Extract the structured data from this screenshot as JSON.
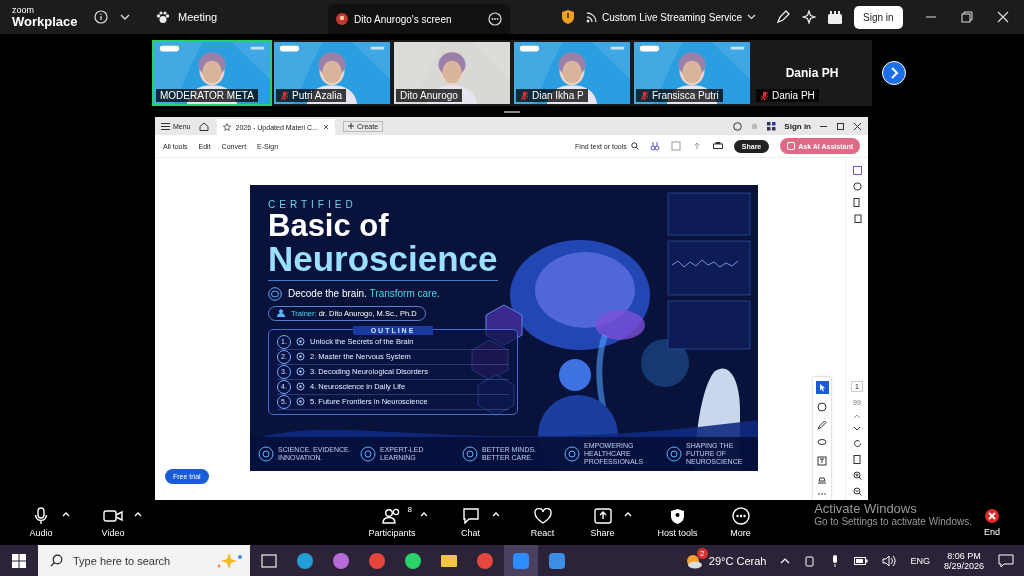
{
  "app": {
    "brand_top": "zoom",
    "brand_bottom": "Workplace",
    "meeting_label": "Meeting",
    "share_tab": "Dito Anurogo's screen",
    "streaming": "Custom Live Streaming Service",
    "sign_in": "Sign in"
  },
  "participants": [
    {
      "name": "MODERATOR META",
      "kind": "branded_video",
      "muted": false,
      "active": true
    },
    {
      "name": "Putri Azalia",
      "kind": "branded_video",
      "muted": true,
      "active": false
    },
    {
      "name": "Dito Anurogo",
      "kind": "plain_video",
      "muted": false,
      "active": false
    },
    {
      "name": "Dian Ikha P",
      "kind": "branded_video",
      "muted": true,
      "active": false
    },
    {
      "name": "Fransisca Putri",
      "kind": "branded_video",
      "muted": true,
      "active": false
    },
    {
      "name": "Dania PH",
      "kind": "no_video",
      "display_name": "Dania PH",
      "muted": true,
      "active": false
    }
  ],
  "pdf": {
    "menu": "Menu",
    "tab_title": "2026 - Updated Materi C...",
    "create": "Create",
    "sign_in": "Sign in",
    "tools": [
      "All tools",
      "Edit",
      "Convert",
      "E-Sign"
    ],
    "find": "Find text or tools",
    "share": "Share",
    "ai": "Ask AI Assistant",
    "free_trial": "Free trial",
    "page_number": "1",
    "page_count": "99"
  },
  "slide": {
    "eyebrow": "CERTIFIED",
    "title_1": "Basic of",
    "title_2": "Neuroscience",
    "tagline_1": "Decode the brain.",
    "tagline_2": "Transform care.",
    "trainer_label": "Trainer:",
    "trainer": "dr. Dito Anurogo, M.Sc., Ph.D",
    "outline_title": "OUTLINE",
    "outline": [
      {
        "number": "1.",
        "text": "Unlock the Secrets of the Brain"
      },
      {
        "number": "2.",
        "text": "2. Master the Nervous System"
      },
      {
        "number": "3.",
        "text": "3. Decoding Neurological Disorders"
      },
      {
        "number": "4.",
        "text": "4. Neuroscience in Daily Life"
      },
      {
        "number": "5.",
        "text": "5. Future Frontiers in Neuroscience"
      }
    ],
    "features": [
      "SCIENCE. EVIDENCE. INNOVATION.",
      "EXPERT-LED LEARNING",
      "BETTER MINDS. BETTER CARE.",
      "EMPOWERING HEALTHCARE PROFESSIONALS",
      "SHAPING THE FUTURE OF NEUROSCIENCE"
    ]
  },
  "controls": [
    {
      "label": "Audio",
      "kind": "mic",
      "caret": true
    },
    {
      "label": "Video",
      "kind": "camera",
      "caret": true
    },
    {
      "label": "Participants",
      "kind": "people",
      "caret": true,
      "count": "8"
    },
    {
      "label": "Chat",
      "kind": "chat",
      "caret": true
    },
    {
      "label": "React",
      "kind": "heart",
      "caret": false
    },
    {
      "label": "Share",
      "kind": "share",
      "caret": true
    },
    {
      "label": "Host tools",
      "kind": "shield",
      "caret": false
    },
    {
      "label": "More",
      "kind": "more",
      "caret": false
    }
  ],
  "end_label": "End",
  "os_notice": {
    "title": "Activate Windows",
    "body": "Go to Settings to activate Windows."
  },
  "taskbar": {
    "search_placeholder": "Type here to search",
    "apps": [
      {
        "kind": "taskview",
        "selected": false
      },
      {
        "kind": "edge",
        "selected": false
      },
      {
        "kind": "copilot",
        "selected": false
      },
      {
        "kind": "chrome",
        "selected": false
      },
      {
        "kind": "whatsapp",
        "selected": false
      },
      {
        "kind": "folder",
        "selected": false
      },
      {
        "kind": "chrome",
        "selected": false
      },
      {
        "kind": "zoom",
        "selected": true
      },
      {
        "kind": "photos",
        "selected": false
      }
    ],
    "weather_badge": "2",
    "weather": "29°C Cerah",
    "language": "ENG",
    "time": "8:06 PM",
    "date": "8/29/2026"
  }
}
